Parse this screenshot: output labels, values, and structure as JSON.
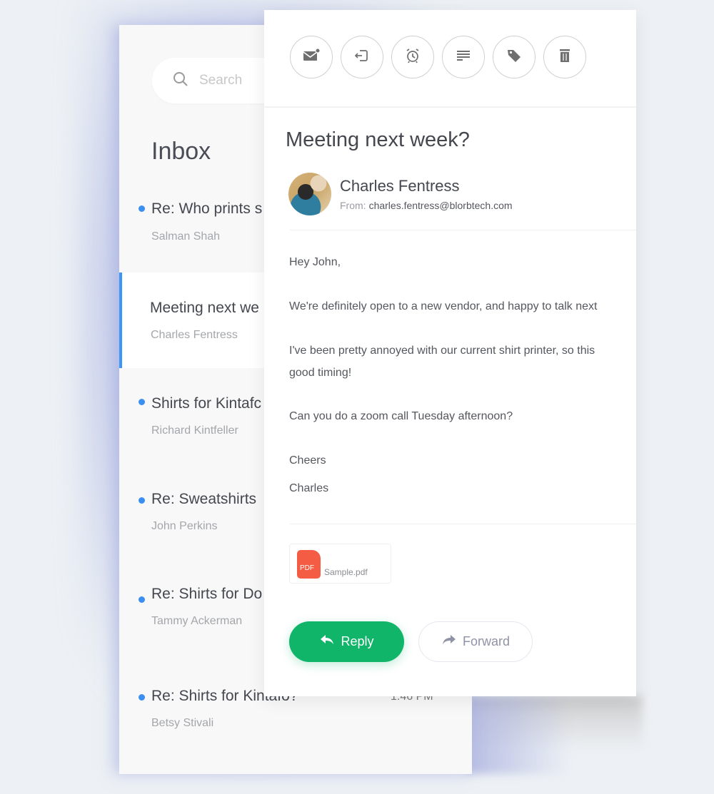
{
  "search": {
    "placeholder": "Search",
    "icon": "search-icon"
  },
  "inbox": {
    "title": "Inbox",
    "messages": [
      {
        "subject": "Re: Who prints s",
        "sender": "Salman Shah",
        "unread": true,
        "selected": false,
        "time": ""
      },
      {
        "subject": "Meeting next we",
        "sender": "Charles Fentress",
        "unread": false,
        "selected": true,
        "time": ""
      },
      {
        "subject": "Shirts for Kintafc",
        "sender": "Richard Kintfeller",
        "unread": true,
        "selected": false,
        "time": ""
      },
      {
        "subject": "Re: Sweatshirts",
        "sender": "John Perkins",
        "unread": true,
        "selected": false,
        "time": ""
      },
      {
        "subject": "Re: Shirts for Do",
        "sender": "Tammy Ackerman",
        "unread": true,
        "selected": false,
        "time": ""
      },
      {
        "subject": "Re: Shirts for Kintafo?",
        "sender": "Betsy Stivali",
        "unread": true,
        "selected": false,
        "time": "1:46 PM"
      }
    ]
  },
  "toolbar": {
    "buttons": [
      {
        "name": "mark-unread",
        "icon": "mail-unread-icon"
      },
      {
        "name": "move",
        "icon": "move-out-icon"
      },
      {
        "name": "snooze",
        "icon": "alarm-clock-icon"
      },
      {
        "name": "notes",
        "icon": "text-lines-icon"
      },
      {
        "name": "tag",
        "icon": "tag-icon"
      },
      {
        "name": "delete",
        "icon": "trash-icon"
      }
    ]
  },
  "email": {
    "subject": "Meeting next week?",
    "sender_name": "Charles Fentress",
    "from_label": "From:",
    "from_address": "charles.fentress@blorbtech.com",
    "body": [
      "Hey John,",
      "We're definitely open to a new vendor, and happy to talk next",
      "I've been pretty annoyed with our current shirt printer, so this",
      "good timing!",
      "Can you do a zoom call Tuesday afternoon?",
      "Cheers",
      "Charles"
    ],
    "attachment": {
      "badge": "PDF",
      "name": "Sample.pdf"
    },
    "reply_label": "Reply",
    "forward_label": "Forward"
  },
  "colors": {
    "accent_blue": "#3b97f7",
    "reply_green": "#10b56a",
    "pdf_red": "#f45c43",
    "background": "#edf1f5"
  }
}
